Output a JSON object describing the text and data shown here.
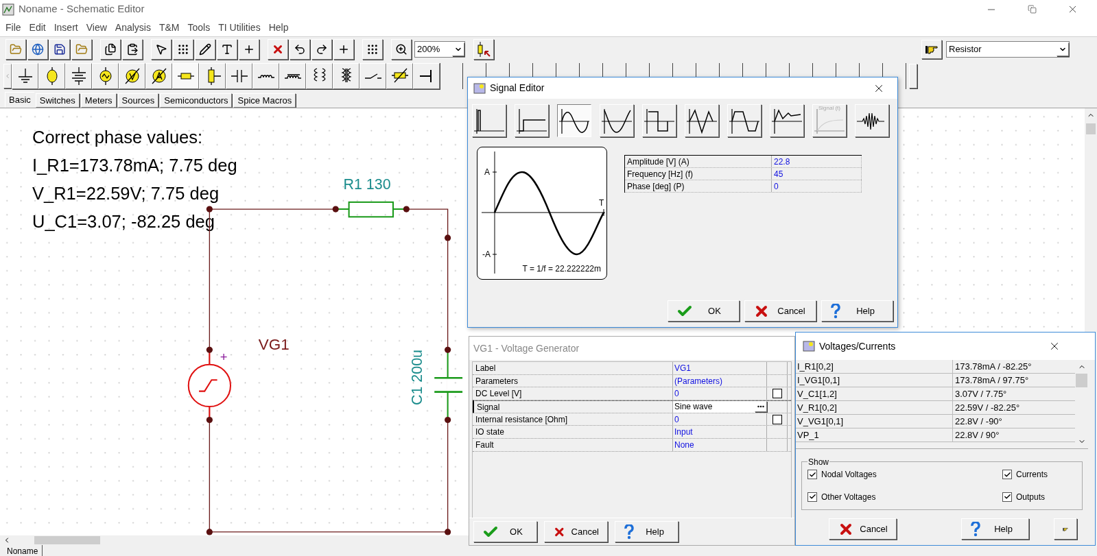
{
  "window": {
    "title": "Noname - Schematic Editor"
  },
  "menu": [
    "File",
    "Edit",
    "Insert",
    "View",
    "Analysis",
    "T&M",
    "Tools",
    "TI Utilities",
    "Help"
  ],
  "toolbar": {
    "zoom": "200%",
    "component": "Resistor"
  },
  "part_tabs": [
    {
      "label": "Basic",
      "selected": true
    },
    {
      "label": "Switches",
      "selected": false
    },
    {
      "label": "Meters",
      "selected": false
    },
    {
      "label": "Sources",
      "selected": false
    },
    {
      "label": "Semiconductors",
      "selected": false
    },
    {
      "label": "Spice Macros",
      "selected": false
    }
  ],
  "schematic": {
    "note": [
      "Correct phase values:",
      "I_R1=173.78mA; 7.75 deg",
      "V_R1=22.59V; 7.75 deg",
      "U_C1=3.07; -82.25 deg"
    ],
    "resistor_label": "R1 130",
    "generator_label": "VG1",
    "capacitor_label": "C1 200u",
    "polarity": "+"
  },
  "signal_editor": {
    "title": "Signal Editor",
    "waveforms": [
      {
        "kind": "impulse",
        "selected": false,
        "disabled": false
      },
      {
        "kind": "step",
        "selected": false,
        "disabled": false
      },
      {
        "kind": "sine",
        "selected": true,
        "disabled": false
      },
      {
        "kind": "cosine",
        "selected": false,
        "disabled": false
      },
      {
        "kind": "square",
        "selected": false,
        "disabled": false
      },
      {
        "kind": "triangle",
        "selected": false,
        "disabled": false
      },
      {
        "kind": "trapezoid",
        "selected": false,
        "disabled": false
      },
      {
        "kind": "piecewise",
        "selected": false,
        "disabled": false
      },
      {
        "kind": "general",
        "label": "Signal (t)",
        "selected": false,
        "disabled": true
      },
      {
        "kind": "noise",
        "selected": false,
        "disabled": false
      }
    ],
    "preview": {
      "top": "A",
      "bottom": "-A",
      "end": "T",
      "period": "T = 1/f = 22.222222m"
    },
    "params": [
      {
        "name": "Amplitude [V] (A)",
        "value": "22.8"
      },
      {
        "name": "Frequency [Hz] (f)",
        "value": "45"
      },
      {
        "name": "Phase [deg] (P)",
        "value": "0"
      }
    ],
    "buttons": [
      {
        "kind": "ok",
        "label": "OK"
      },
      {
        "kind": "cancel",
        "label": "Cancel"
      },
      {
        "kind": "help",
        "label": "Help"
      }
    ]
  },
  "generator_dialog": {
    "title": "VG1 - Voltage Generator",
    "rows": [
      {
        "name": "Label",
        "value": "VG1",
        "selected": false
      },
      {
        "name": "Parameters",
        "value": "(Parameters)",
        "selected": false
      },
      {
        "name": "DC Level [V]",
        "value": "0",
        "selected": false,
        "checked": false
      },
      {
        "name": "Signal",
        "value": "Sine wave",
        "selected": true
      },
      {
        "name": "Internal resistance [Ohm]",
        "value": "0",
        "selected": false,
        "checked": false
      },
      {
        "name": "IO state",
        "value": "Input",
        "selected": false
      },
      {
        "name": "Fault",
        "value": "None",
        "selected": false
      }
    ],
    "buttons": [
      {
        "kind": "ok",
        "label": "OK"
      },
      {
        "kind": "cancel",
        "label": "Cancel"
      },
      {
        "kind": "help",
        "label": "Help"
      }
    ]
  },
  "results_dialog": {
    "title": "Voltages/Currents",
    "rows": [
      {
        "name": "I_R1[0,2]",
        "value": "173.78mA / -82.25°"
      },
      {
        "name": "I_VG1[0,1]",
        "value": "173.78mA / 97.75°"
      },
      {
        "name": "V_C1[1,2]",
        "value": "3.07V / 7.75°"
      },
      {
        "name": "V_R1[0,2]",
        "value": "22.59V / -82.25°"
      },
      {
        "name": "V_VG1[0,1]",
        "value": "22.8V / -90°"
      },
      {
        "name": "VP_1",
        "value": "22.8V / 90°"
      }
    ],
    "show": {
      "title": "Show",
      "options": [
        {
          "label": "Nodal Voltages",
          "checked": true
        },
        {
          "label": "Currents",
          "checked": true
        },
        {
          "label": "Other Voltages",
          "checked": true
        },
        {
          "label": "Outputs",
          "checked": true
        }
      ]
    },
    "buttons": [
      {
        "kind": "cancel",
        "label": "Cancel"
      },
      {
        "kind": "help",
        "label": "Help"
      },
      {
        "kind": "hand"
      }
    ]
  },
  "status_bar": {
    "tab": "Noname"
  }
}
